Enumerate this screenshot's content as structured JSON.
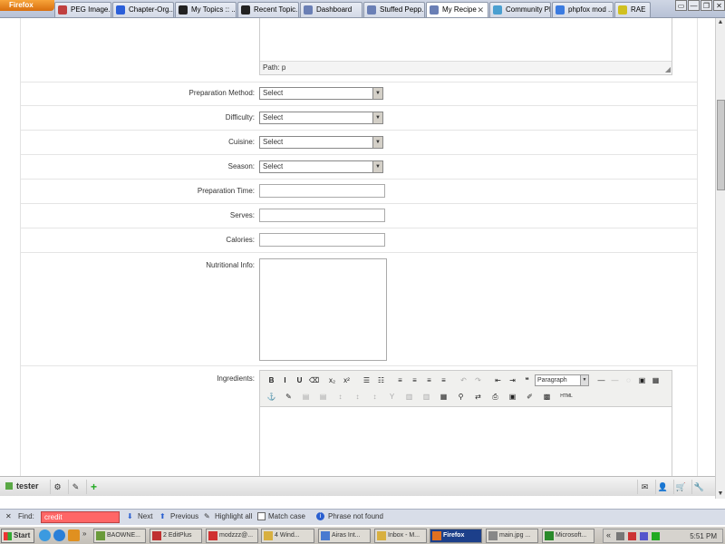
{
  "browser": {
    "app_button": "Firefox",
    "tabs": [
      {
        "label": "PEG Image...",
        "color": "#c04040"
      },
      {
        "label": "Chapter-Org...",
        "color": "#2b5fd9"
      },
      {
        "label": "My Topics :: ...",
        "color": "#222222"
      },
      {
        "label": "Recent Topic...",
        "color": "#222222"
      },
      {
        "label": "Dashboard",
        "color": "#6a7fb5"
      },
      {
        "label": "Stuffed Pepp...",
        "color": "#6a7fb5"
      },
      {
        "label": "My Recipe",
        "color": "#6a7fb5",
        "active": true
      },
      {
        "label": "Community Pl...",
        "color": "#4a9fd0"
      },
      {
        "label": "phpfox mod ...",
        "color": "#3b7be0"
      },
      {
        "label": "RAE",
        "color": "#d0c020"
      }
    ],
    "window_controls": [
      "▭",
      "—",
      "❐",
      "✕"
    ],
    "scroll_up": "▲",
    "scroll_down": "▼"
  },
  "form": {
    "editor_path": "Path: p",
    "resize_grip": "◢",
    "fields": {
      "preparation_method": {
        "label": "Preparation Method:",
        "value": "Select"
      },
      "difficulty": {
        "label": "Difficulty:",
        "value": "Select"
      },
      "cuisine": {
        "label": "Cuisine:",
        "value": "Select"
      },
      "season": {
        "label": "Season:",
        "value": "Select"
      },
      "preparation_time": {
        "label": "Preparation Time:",
        "value": ""
      },
      "serves": {
        "label": "Serves:",
        "value": ""
      },
      "calories": {
        "label": "Calories:",
        "value": ""
      },
      "nutritional_info": {
        "label": "Nutritional Info:",
        "value": ""
      },
      "ingredients": {
        "label": "Ingredients:"
      }
    },
    "dropdown_arrow": "▼",
    "toolbar": {
      "row1": [
        "B",
        "I",
        "U",
        "⌫",
        "x₂",
        "x²",
        "☰",
        "☷",
        "≡",
        "≡",
        "≡",
        "≡",
        "↶",
        "↷",
        "⇤",
        "⇥",
        "❝"
      ],
      "format_select": "Paragraph",
      "row1_end": [
        "—",
        "—",
        "◌",
        "▣",
        "▦"
      ],
      "row2": [
        "⚓",
        "✎",
        "▤",
        "▤",
        "↕",
        "↕",
        "↕",
        "Y",
        "▥",
        "▥",
        "▦",
        "⚲",
        "⇄",
        "⎙",
        "▣",
        "✐",
        "▩",
        "HTML"
      ]
    }
  },
  "dock": {
    "username": "tester",
    "left_icons": [
      "⚙",
      "✎",
      "+"
    ],
    "right_icons": [
      "✉",
      "👤",
      "🛒",
      "🔧"
    ]
  },
  "findbar": {
    "close": "✕",
    "label": "Find:",
    "value": "credit",
    "next": "Next",
    "previous": "Previous",
    "highlight": "Highlight all",
    "match_case": "Match case",
    "status": "Phrase not found"
  },
  "taskbar": {
    "start": "Start",
    "tasks": [
      {
        "label": "BAOWNE...",
        "color": "#6a9a3a"
      },
      {
        "label": "2 EditPlus",
        "color": "#c03030"
      },
      {
        "label": "modzzz@...",
        "color": "#d03030"
      },
      {
        "label": "4 Wind...",
        "color": "#d8b040"
      },
      {
        "label": "Airas Int...",
        "color": "#4a7ad0"
      },
      {
        "label": "Inbox - M...",
        "color": "#d8b040"
      },
      {
        "label": "Firefox",
        "color": "#e07020",
        "active": true
      },
      {
        "label": "main.jpg ...",
        "color": "#888888"
      },
      {
        "label": "Microsoft...",
        "color": "#2a8a2a"
      }
    ],
    "tray_more": "«",
    "clock": "5:51 PM"
  }
}
